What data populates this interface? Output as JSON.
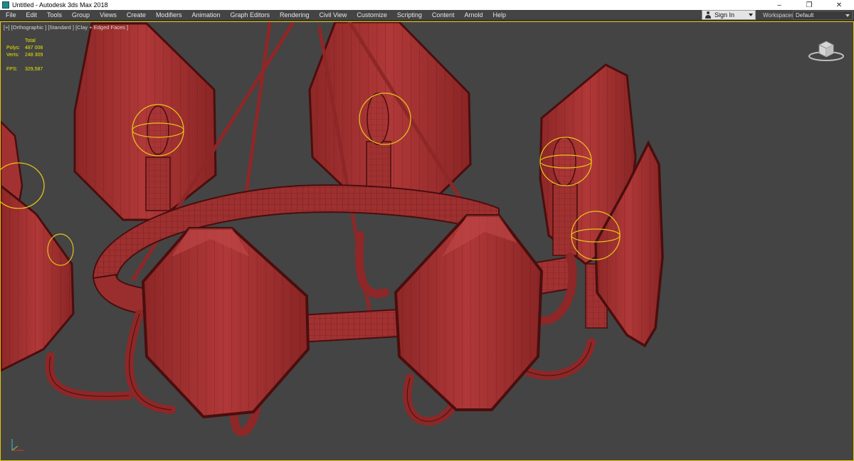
{
  "window": {
    "title": "Untitled - Autodesk 3ds Max 2018",
    "minimize": "–",
    "restore": "❐",
    "close": "✕"
  },
  "menu": [
    "File",
    "Edit",
    "Tools",
    "Group",
    "Views",
    "Create",
    "Modifiers",
    "Animation",
    "Graph Editors",
    "Rendering",
    "Civil View",
    "Customize",
    "Scripting",
    "Content",
    "Arnold",
    "Help"
  ],
  "account": {
    "signin_label": "Sign In"
  },
  "workspaces": {
    "label": "Workspaces:",
    "value": "Default"
  },
  "viewport": {
    "label": "[+] [Orthographic ] [Standard ] [Clay + Edged Faces ]",
    "stats": {
      "header": "Total",
      "polys_label": "Polys:",
      "polys_value": "487 008",
      "verts_label": "Verts:",
      "verts_value": "248 309",
      "fps_label": "FPS:",
      "fps_value": "329,587"
    }
  },
  "colors": {
    "viewport_bg": "#444444",
    "clay": "#a33232",
    "wire": "#4a0e0e",
    "selection": "#e6c21a",
    "stats_text": "#e8e400",
    "active_border": "#e8c600"
  }
}
